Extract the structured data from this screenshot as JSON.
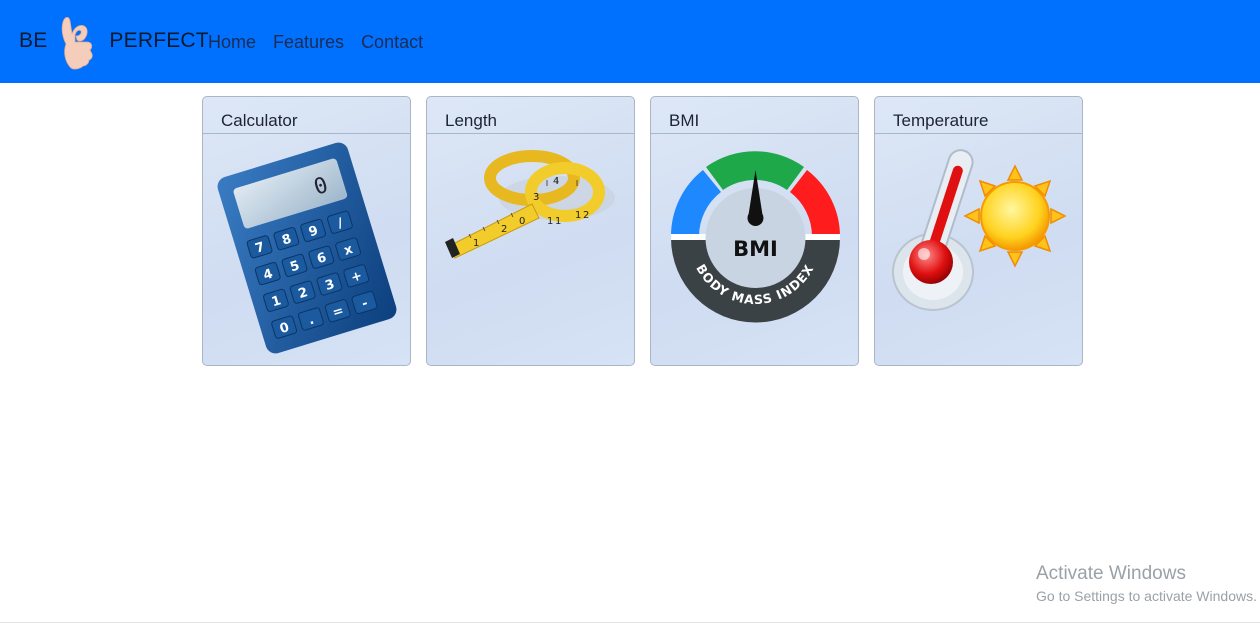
{
  "brand": {
    "left_text": "BE",
    "right_text": "PERFECT",
    "icon": "ok-hand-icon"
  },
  "nav": {
    "items": [
      {
        "label": "Home"
      },
      {
        "label": "Features"
      },
      {
        "label": "Contact"
      }
    ]
  },
  "cards": [
    {
      "title": "Calculator",
      "icon": "calculator-icon",
      "keys": [
        "7",
        "8",
        "9",
        "/",
        "4",
        "5",
        "6",
        "x",
        "1",
        "2",
        "3",
        "+",
        "0",
        ".",
        "=",
        "-"
      ],
      "display": "0"
    },
    {
      "title": "Length",
      "icon": "tape-measure-icon",
      "marks": [
        "1",
        "2",
        "3",
        "4",
        "1",
        "1",
        "1",
        "2",
        "0"
      ]
    },
    {
      "title": "BMI",
      "icon": "bmi-gauge-icon",
      "gauge_label": "BMI",
      "ring_text": "BODY MASS INDEX"
    },
    {
      "title": "Temperature",
      "icon": "thermometer-sun-icon"
    }
  ],
  "watermark": {
    "title": "Activate Windows",
    "subtitle": "Go to Settings to activate Windows."
  },
  "colors": {
    "navbar": "#0070ff",
    "card_bg": "#d6e2f5",
    "gauge_blue": "#1e88ff",
    "gauge_green": "#1ea84a",
    "gauge_red": "#ff1c1c",
    "gauge_dark": "#3b4246"
  }
}
